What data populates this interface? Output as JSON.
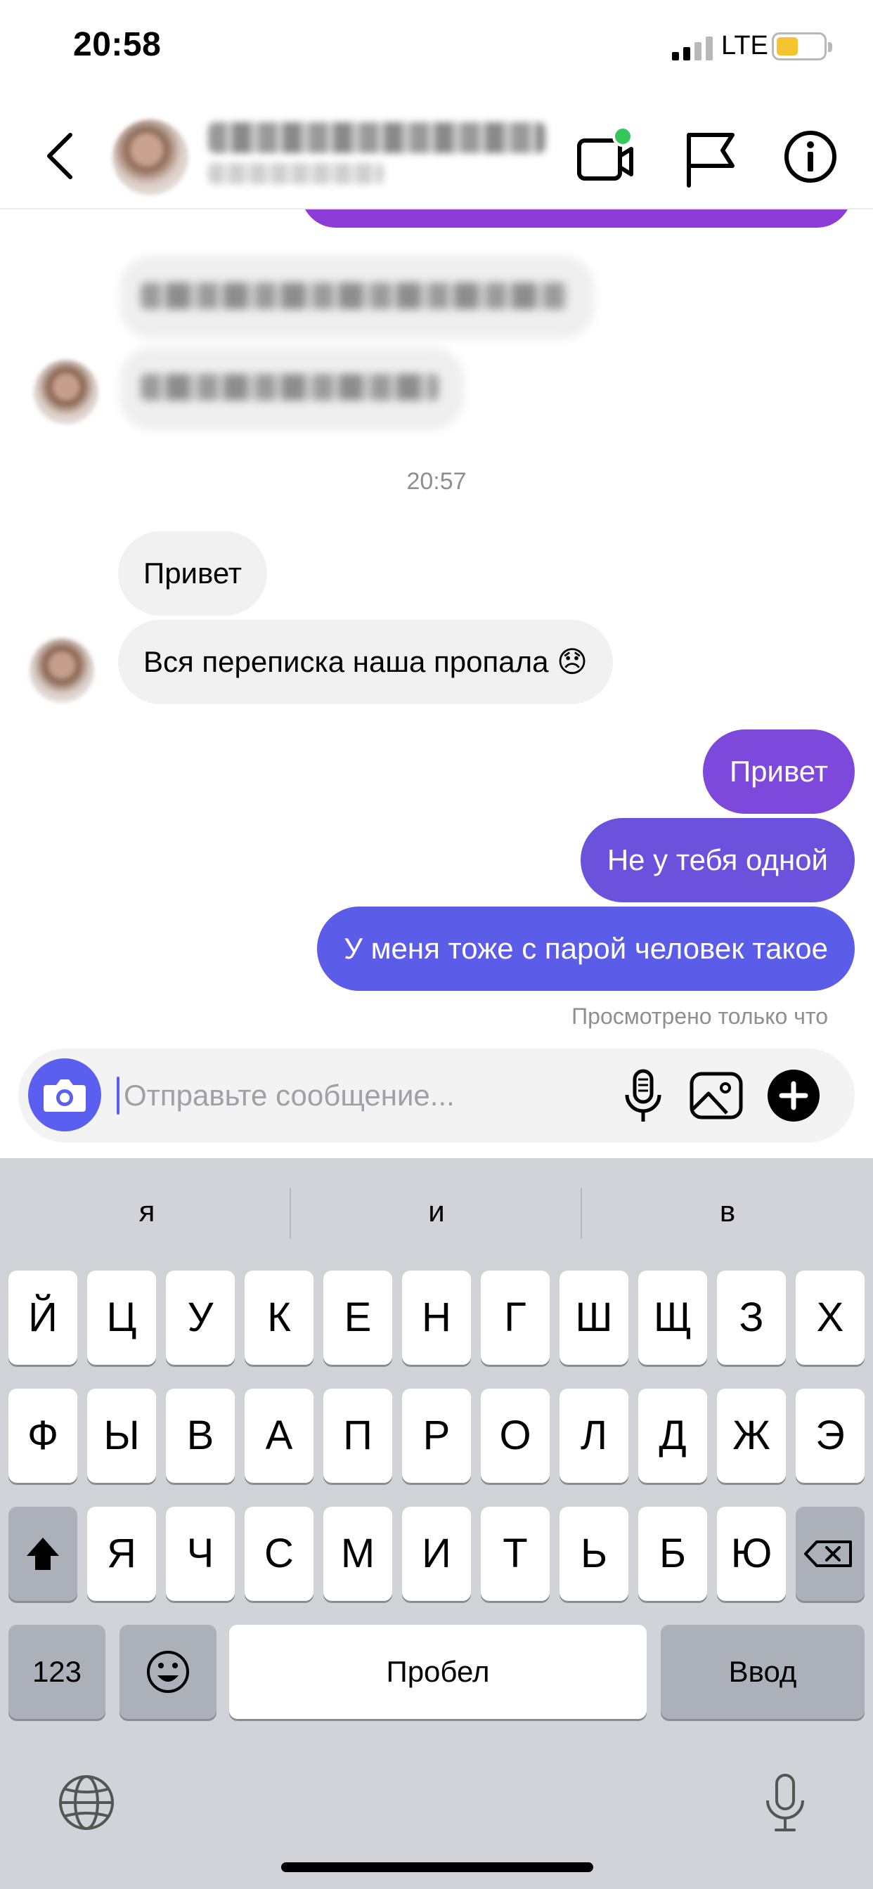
{
  "status_bar": {
    "time": "20:58",
    "network": "LTE"
  },
  "header": {
    "icons": [
      "back-icon",
      "video-call-icon",
      "flag-icon",
      "info-icon"
    ],
    "online_dot_color": "#35c759"
  },
  "chat": {
    "timestamp": "20:57",
    "incoming": [
      "Привет",
      "Вся переписка наша пропала 😞"
    ],
    "outgoing": [
      "Привет",
      "Не у тебя одной",
      "У меня тоже с парой человек такое"
    ],
    "seen_status": "Просмотрено только что",
    "colors": {
      "outgoing_top": "#7d48dc",
      "outgoing_mid": "#6a52dc",
      "outgoing_bottom": "#5b5ce8",
      "incoming": "#f1f1f1"
    }
  },
  "composer": {
    "placeholder": "Отправьте сообщение...",
    "value": ""
  },
  "keyboard": {
    "suggestions": [
      "я",
      "и",
      "в"
    ],
    "row1": [
      "Й",
      "Ц",
      "У",
      "К",
      "Е",
      "Н",
      "Г",
      "Ш",
      "Щ",
      "З",
      "Х"
    ],
    "row2": [
      "Ф",
      "Ы",
      "В",
      "А",
      "П",
      "Р",
      "О",
      "Л",
      "Д",
      "Ж",
      "Э"
    ],
    "row3": [
      "Я",
      "Ч",
      "С",
      "М",
      "И",
      "Т",
      "Ь",
      "Б",
      "Ю"
    ],
    "numbers_label": "123",
    "space_label": "Пробел",
    "return_label": "Ввод"
  }
}
